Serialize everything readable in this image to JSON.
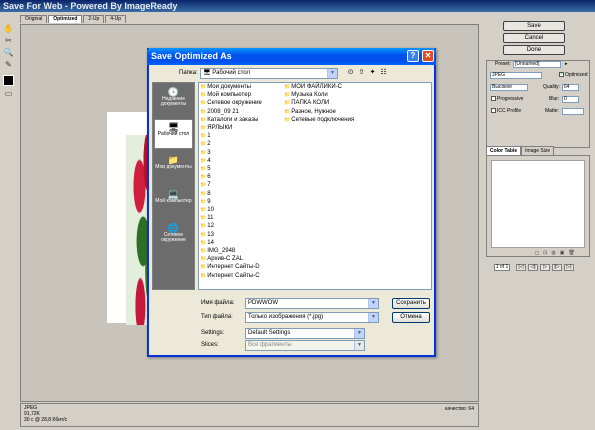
{
  "app": {
    "title": "Save For Web - Powered By ImageReady"
  },
  "tabs": [
    "Original",
    "Optimized",
    "2-Up",
    "4-Up"
  ],
  "right_panel": {
    "save": "Save",
    "cancel": "Cancel",
    "done": "Done",
    "preset_label": "Preset:",
    "preset_value": "[Unnamed]",
    "format": "JPEG",
    "optimized_label": "Optimized",
    "quality_level": "Высокое",
    "quality_label": "Quality:",
    "quality_value": "64",
    "progressive_label": "Progressive",
    "blur_label": "Blur:",
    "blur_value": "0",
    "icc_label": "ICC Profile",
    "matte_label": "Matte:",
    "tab_color_table": "Color Table",
    "tab_image_size": "Image Size",
    "nav_count": "1 of 1"
  },
  "status": {
    "line1": "JPEG",
    "line2": "91,72K",
    "line3": "30 с @ 28,8 Кбит/с",
    "quality": "качество: 64"
  },
  "dialog": {
    "title": "Save Optimized As",
    "help": "?",
    "close": "✕",
    "folder_label": "Папка:",
    "folder_value": "Рабочий стол",
    "places": [
      {
        "label": "Недавние документы"
      },
      {
        "label": "Рабочий стол"
      },
      {
        "label": "Мои документы"
      },
      {
        "label": "Мой компьютер"
      },
      {
        "label": "Сетевое окружение"
      }
    ],
    "files_col1": [
      "Мои документы",
      "Мой компьютер",
      "Сетевое окружение",
      "2008_09 21",
      "Каталоги и заказы",
      "ЯРЛЫКИ",
      "1",
      "2",
      "3",
      "4",
      "5",
      "6",
      "7",
      "8",
      "9",
      "10",
      "11",
      "12",
      "13",
      "14",
      "IMG_2948",
      "Архив-C ZAL",
      "Интернет Сайты-D",
      "Интернет Сайты-C"
    ],
    "files_col2": [
      "МОИ ФАЙЛИКИ-C",
      "Музыка Коли",
      "ПАПКА КОЛИ",
      "Разное, Нужное",
      "Сетевые подключения"
    ],
    "filename_label": "Имя файла:",
    "filename_value": "PDWWOW",
    "filetype_label": "Тип файла:",
    "filetype_value": "Только изображения (*.jpg)",
    "settings_label": "Settings:",
    "settings_value": "Default Settings",
    "slices_label": "Slices:",
    "slices_value": "Все фрагменты",
    "save_button": "Сохранить",
    "cancel_button": "Отмена"
  }
}
